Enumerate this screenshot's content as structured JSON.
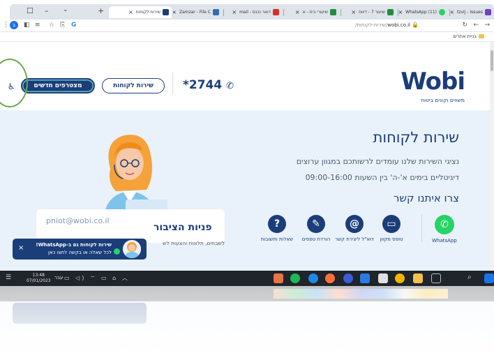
{
  "browser": {
    "tabs": [
      {
        "title": "שירות לקוחות",
        "color": "#1b3d7a",
        "active": true
      },
      {
        "title": "Zamzar - File C",
        "color": "#2f6fb0",
        "active": false
      },
      {
        "title": "דואר נכנס - mail",
        "color": "#d93025",
        "active": false
      },
      {
        "title": "שיעורי בית - א",
        "color": "#1e8e3e",
        "active": false
      },
      {
        "title": "שיעור 7 - דיווח",
        "color": "#1e8e3e",
        "active": false
      },
      {
        "title": "(11) WhatsApp",
        "color": "#25d366",
        "active": false
      },
      {
        "title": "tzvij - Issues",
        "color": "#6f42c1",
        "active": false
      }
    ],
    "new_tab": "+",
    "url_domain": "wobi.co.il",
    "url_path": "/שירות-לקוחות/",
    "bookmark": "בניית אתרים"
  },
  "header": {
    "logo": "Wobi",
    "logo_tagline": "משווים וקונים ביטוח",
    "phone": "*2744",
    "service_button": "שירות לקוחות",
    "new_customers_button": "מצטרפים חדשים",
    "accessibility_icon": "accessibility-icon"
  },
  "hero": {
    "title": "שירות לקוחות",
    "line1": "נציגי השירות שלנו עומדים לרשותכם במגוון ערוצים",
    "line2": "דיגיטליים בימים א'-ה' בין השעות 09:00-16:00",
    "contact_title": "צרו איתנו קשר"
  },
  "contacts": [
    {
      "label": "WhatsApp",
      "icon": "whatsapp-icon",
      "glyph": "✆"
    },
    {
      "label": "טופס מקוון",
      "icon": "laptop-icon",
      "glyph": "▭"
    },
    {
      "label": "דוא\"ל ליצירת קשר",
      "icon": "email-icon",
      "glyph": "@"
    },
    {
      "label": "הורדת טפסים",
      "icon": "download-form-icon",
      "glyph": "✎"
    },
    {
      "label": "שאלות ותשובות",
      "icon": "question-icon",
      "glyph": "?"
    }
  ],
  "public_inquiries": {
    "email": "pniot@wobi.co.il",
    "title": "פניות הציבור",
    "subtitle": "לשבחים, תלונות והצעות לש"
  },
  "whatsapp_popup": {
    "line1": "שירות לקוחות גם ב-WhatsApp!",
    "line2": "לכל שאלה או בקשה לחצו כאן",
    "close": "×"
  },
  "taskbar": {
    "time": "13:48",
    "date": "07/01/2023",
    "lang": "עבר"
  },
  "colors": {
    "brand": "#1b3d7a",
    "page_bg": "#e9f2fa",
    "whatsapp": "#25d366",
    "taskbar": "#20242b"
  }
}
